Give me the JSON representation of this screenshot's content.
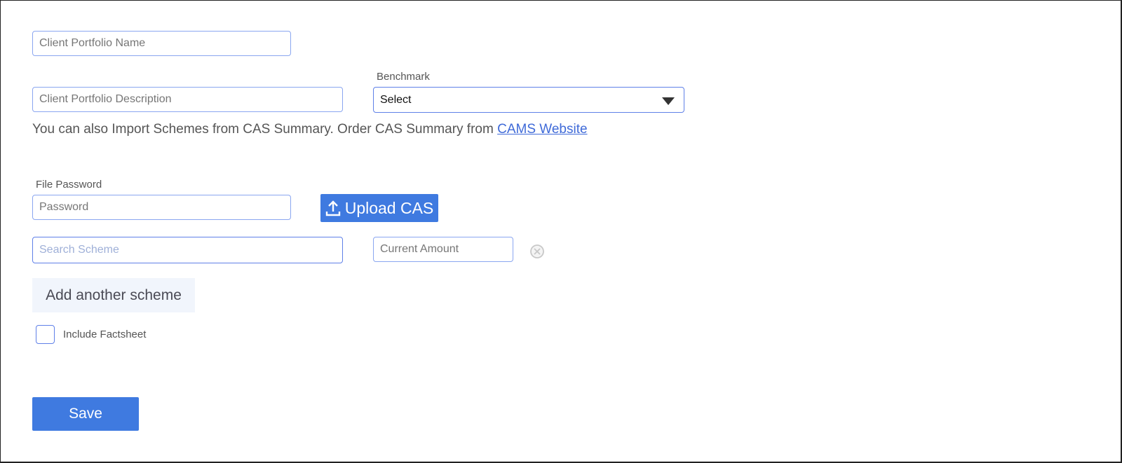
{
  "form": {
    "portfolio_name": {
      "placeholder": "Client Portfolio Name",
      "value": ""
    },
    "portfolio_description": {
      "placeholder": "Client Portfolio Description",
      "value": ""
    },
    "benchmark": {
      "label": "Benchmark",
      "selected": "Select"
    },
    "cas_info": {
      "text": "You can also Import Schemes from CAS Summary. Order CAS Summary from ",
      "link_text": "CAMS Website"
    },
    "file_password": {
      "label": "File Password",
      "placeholder": "Password",
      "value": ""
    },
    "upload_button": {
      "label": "Upload CAS",
      "icon": "upload-icon"
    },
    "scheme_row": {
      "search_placeholder": "Search Scheme",
      "amount_placeholder": "Current Amount",
      "remove_icon": "close-circle-icon"
    },
    "add_scheme_label": "Add another scheme",
    "include_factsheet": {
      "label": "Include Factsheet",
      "checked": false
    },
    "save_label": "Save"
  },
  "colors": {
    "accent": "#3f7ae0",
    "input_border": "#8aa6f0",
    "link": "#3f6ad8",
    "add_scheme_bg": "#f1f5fc"
  }
}
